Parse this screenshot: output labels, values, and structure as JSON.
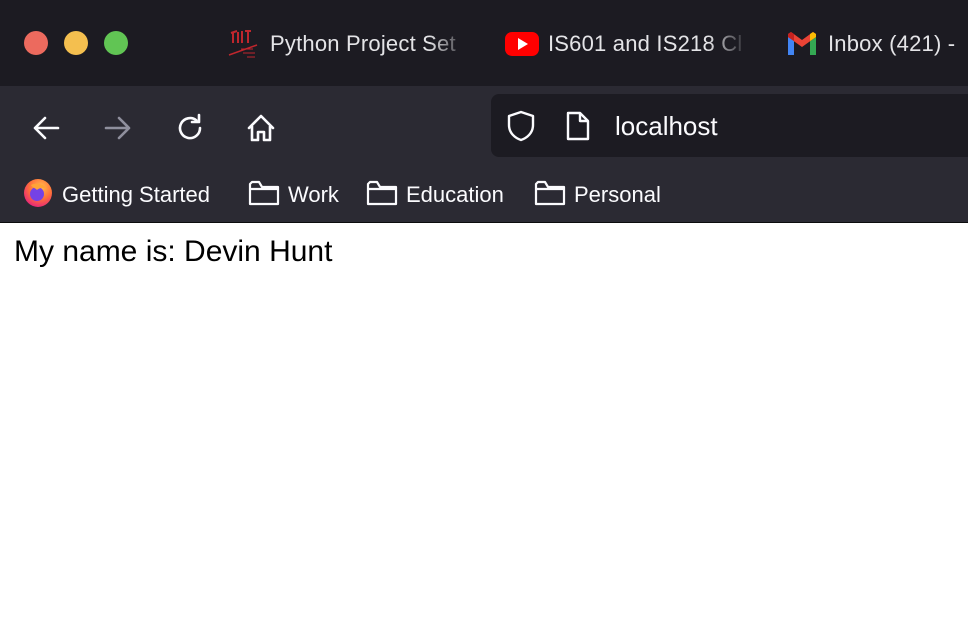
{
  "window": {
    "controls": [
      "close",
      "minimize",
      "maximize"
    ]
  },
  "tabs": [
    {
      "title": "Python Project Set",
      "favicon": "site-logo-icon"
    },
    {
      "title": "IS601 and IS218 Cl",
      "favicon": "youtube-icon"
    },
    {
      "title": "Inbox (421) -",
      "favicon": "gmail-icon"
    }
  ],
  "navigation": {
    "url": "localhost",
    "buttons": [
      "back",
      "forward",
      "reload",
      "home"
    ]
  },
  "bookmarks": [
    {
      "label": "Getting Started",
      "icon": "firefox-icon"
    },
    {
      "label": "Work",
      "icon": "folder-icon"
    },
    {
      "label": "Education",
      "icon": "folder-icon"
    },
    {
      "label": "Personal",
      "icon": "folder-icon"
    }
  ],
  "page": {
    "text": "My name is: Devin Hunt"
  },
  "colors": {
    "tabbar": "#1c1b22",
    "toolbar": "#2b2a33",
    "close": "#ec6a5e",
    "minimize": "#f4bf4f",
    "maximize": "#61c554",
    "youtube_red": "#ff0000"
  }
}
